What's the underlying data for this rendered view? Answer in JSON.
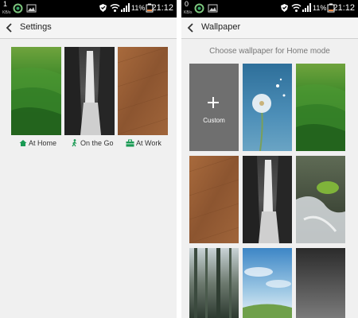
{
  "left": {
    "status": {
      "notif_count": "1",
      "kbs": "KB/s",
      "battery": "11%",
      "time": "21:12"
    },
    "header": {
      "title": "Settings"
    },
    "modes": [
      {
        "label": "At Home",
        "icon": "home-icon"
      },
      {
        "label": "On the Go",
        "icon": "walking-person-icon"
      },
      {
        "label": "At Work",
        "icon": "briefcase-icon"
      }
    ]
  },
  "right": {
    "status": {
      "notif_count": "0",
      "kbs": "KB/s",
      "battery": "11%",
      "time": "21:12"
    },
    "header": {
      "title": "Wallpaper"
    },
    "subtitle": "Choose wallpaper for Home mode",
    "custom_label": "Custom",
    "wallpapers": [
      "custom",
      "dandelion",
      "green-hills",
      "wood",
      "waterfall",
      "stream",
      "forest",
      "sky",
      "dark-gradient"
    ]
  },
  "colors": {
    "accent": "#1a9a54",
    "status_bar": "#000000",
    "custom_tile": "#6f6f6f"
  }
}
